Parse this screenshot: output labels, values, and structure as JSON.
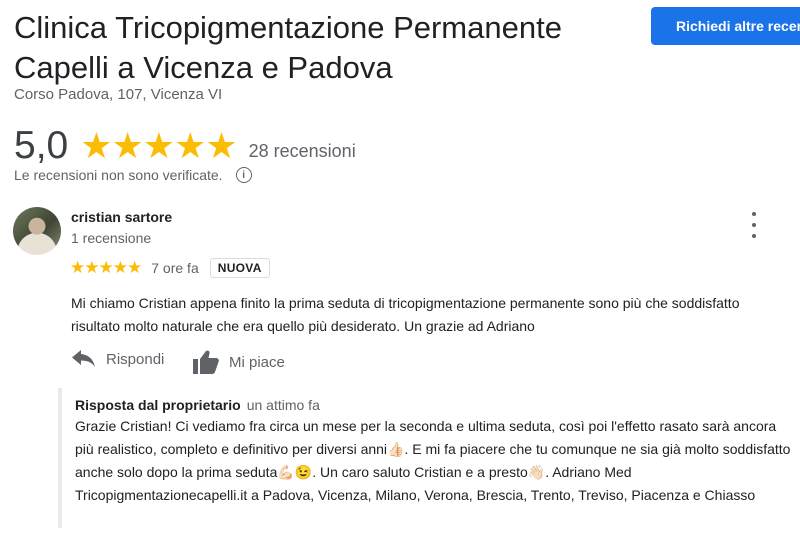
{
  "business": {
    "name": "Clinica Tricopigmentazione Permanente Capelli a Vicenza e Padova",
    "address": "Corso Padova, 107, Vicenza VI",
    "request_button": "Richiedi altre recensioni"
  },
  "rating": {
    "score": "5,0",
    "stars": 5,
    "count_label": "28 recensioni",
    "unverified_note": "Le recensioni non sono verificate."
  },
  "review": {
    "author": "cristian sartore",
    "author_meta": "1 recensione",
    "stars": 5,
    "time": "7 ore fa",
    "badge": "NUOVA",
    "text": "Mi chiamo Cristian appena finito la prima seduta di tricopigmentazione permanente sono più che soddisfatto risultato molto  naturale che era quello più desiderato.  Un grazie ad Adriano",
    "actions": {
      "reply": "Rispondi",
      "like": "Mi piace"
    }
  },
  "owner_reply": {
    "label": "Risposta dal proprietario",
    "time": "un attimo fa",
    "text": "Grazie Cristian! Ci vediamo fra circa un mese per la seconda e ultima seduta, così poi l'effetto rasato sarà ancora più realistico, completo e definitivo per diversi anni👍🏻. E mi fa piacere che tu comunque ne sia già molto soddisfatto anche solo dopo la prima seduta💪🏻😉. Un caro saluto Cristian e a presto👋🏻. Adriano Med Tricopigmentazionecapelli.it a Padova, Vicenza, Milano, Verona, Brescia, Trento, Treviso, Piacenza e Chiasso"
  },
  "colors": {
    "accent": "#1a73e8",
    "star": "#fbbc04",
    "muted_text": "#5f6368"
  },
  "icons": [
    "info-icon",
    "more-vert-icon",
    "star-icon",
    "reply-icon",
    "thumb-up-icon"
  ]
}
